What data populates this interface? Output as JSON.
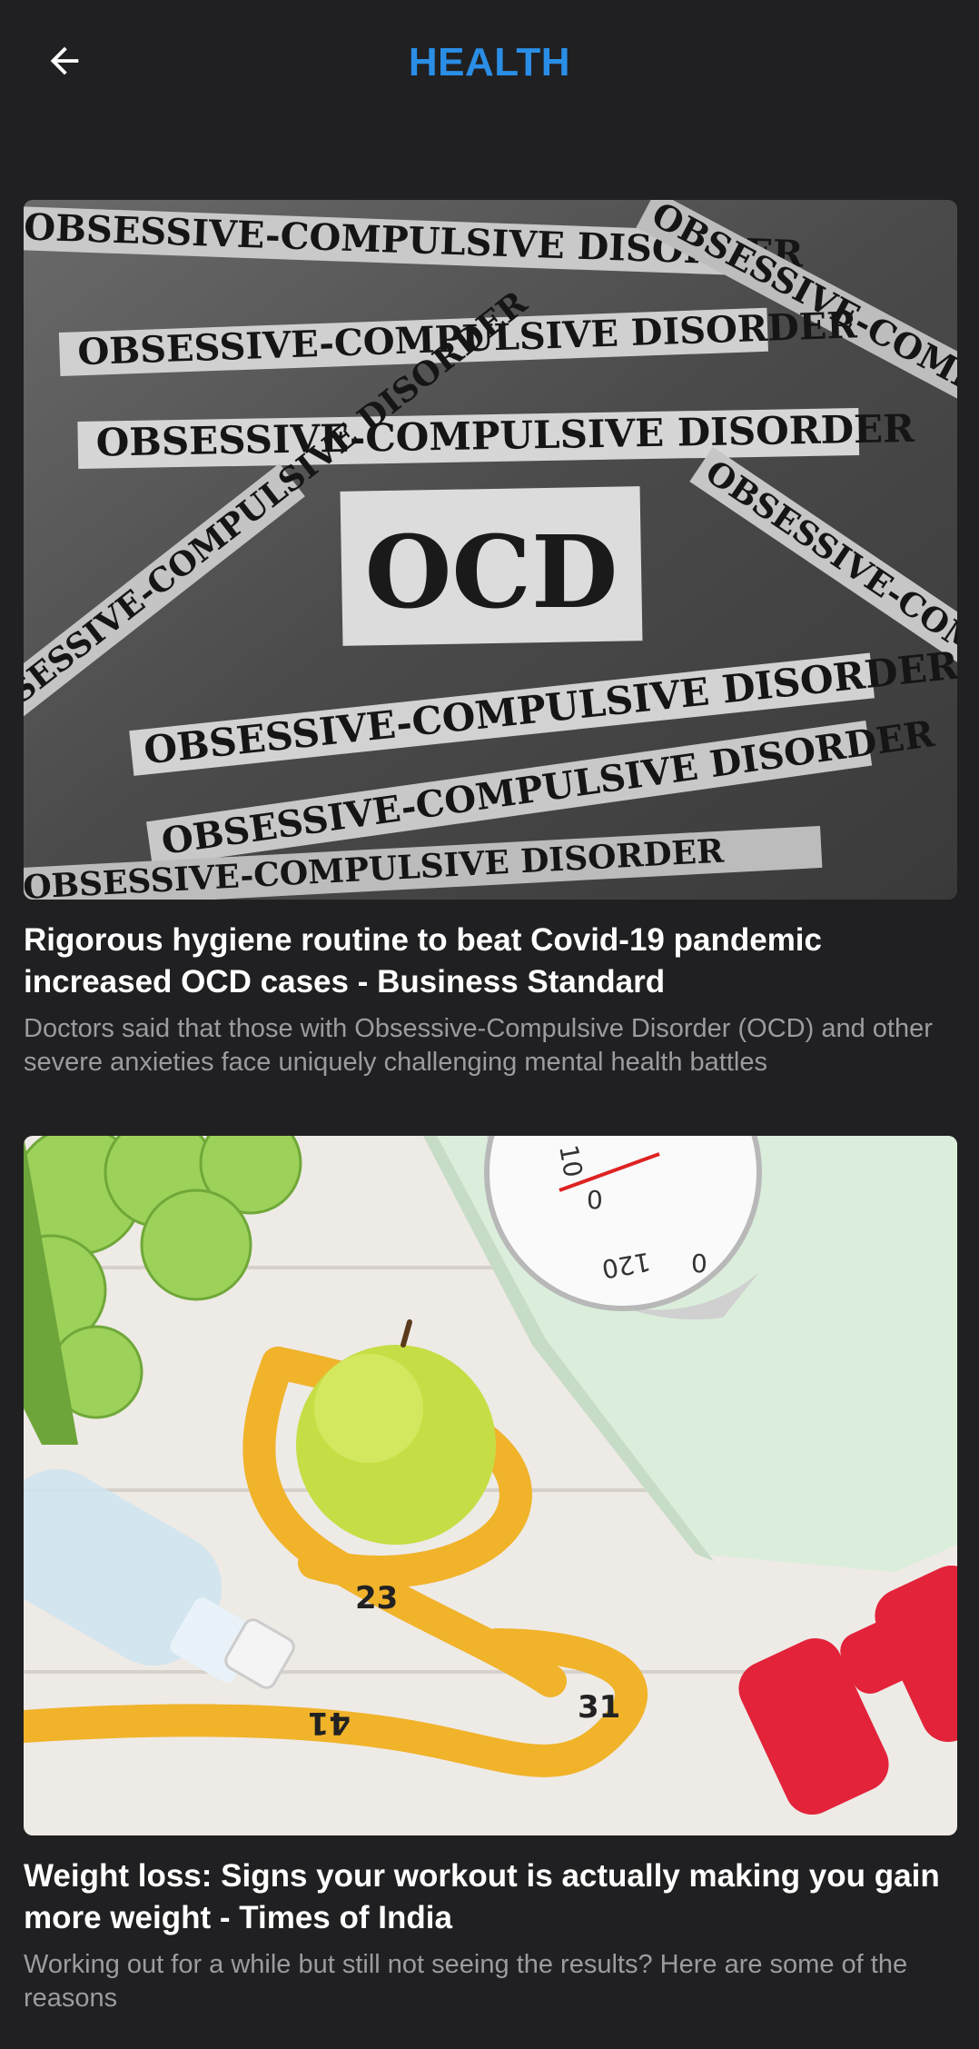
{
  "header": {
    "title": "HEALTH",
    "back_icon": "arrow-left-icon"
  },
  "colors": {
    "background": "#202022",
    "accent": "#2a8ee6",
    "headline": "#ffffff",
    "summary": "#9b9ba0"
  },
  "articles": [
    {
      "headline": "Rigorous hygiene routine to beat Covid-19 pandemic increased OCD cases - Business Standard",
      "summary": "Doctors said that those with Obsessive-Compulsive Disorder (OCD) and other severe anxieties face uniquely challenging mental health battles",
      "image": {
        "center_label": "OCD",
        "strip_text": "OBSESSIVE-COMPULSIVE DISORDER"
      }
    },
    {
      "headline": "Weight loss: Signs your workout is actually making you gain more weight - Times of India",
      "summary": "Working out for a while but still not seeing the results? Here are some of the reasons",
      "image": {
        "scale_numbers": [
          "10",
          "0",
          "120",
          "0"
        ],
        "tape_numbers": [
          "23",
          "31",
          "41"
        ]
      }
    }
  ]
}
